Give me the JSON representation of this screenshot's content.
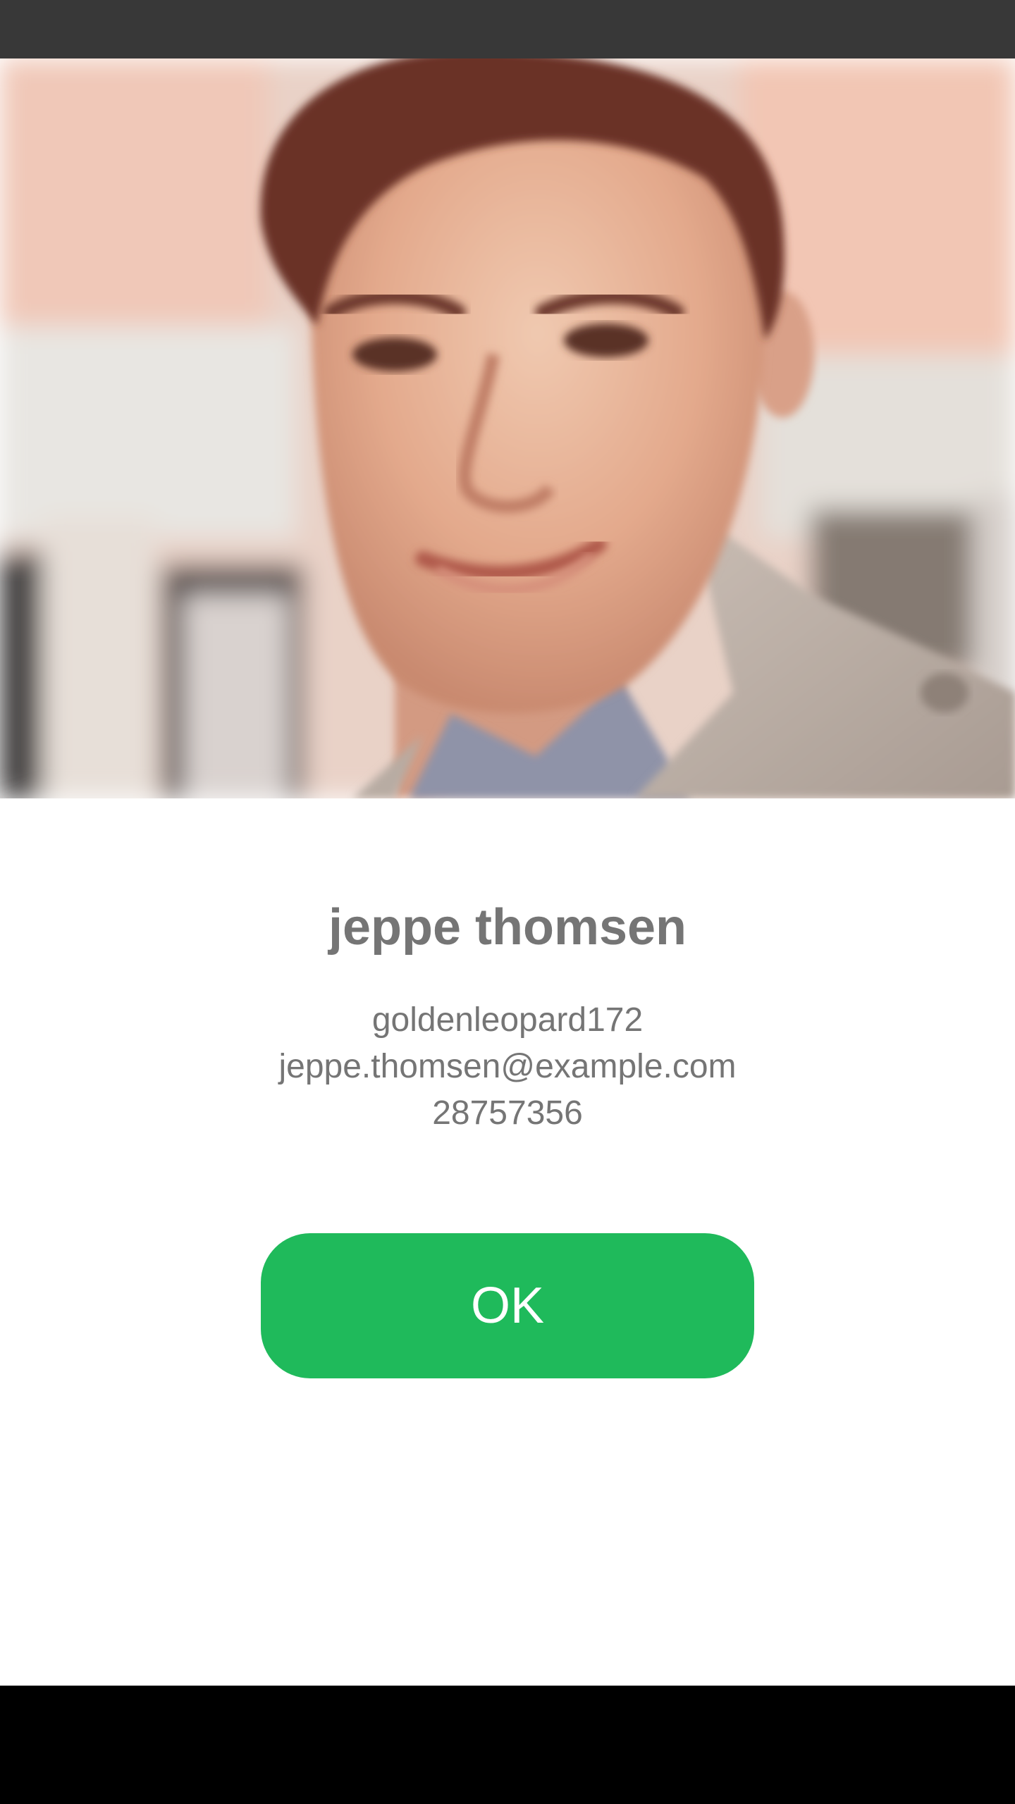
{
  "profile": {
    "name": "jeppe thomsen",
    "username": "goldenleopard172",
    "email": "jeppe.thomsen@example.com",
    "phone": "28757356"
  },
  "actions": {
    "ok_label": "OK"
  },
  "colors": {
    "status_bar": "#383838",
    "text": "#757575",
    "button": "#1fba5b",
    "nav_bar": "#000000"
  },
  "icons": {
    "photo": "profile-photo"
  }
}
